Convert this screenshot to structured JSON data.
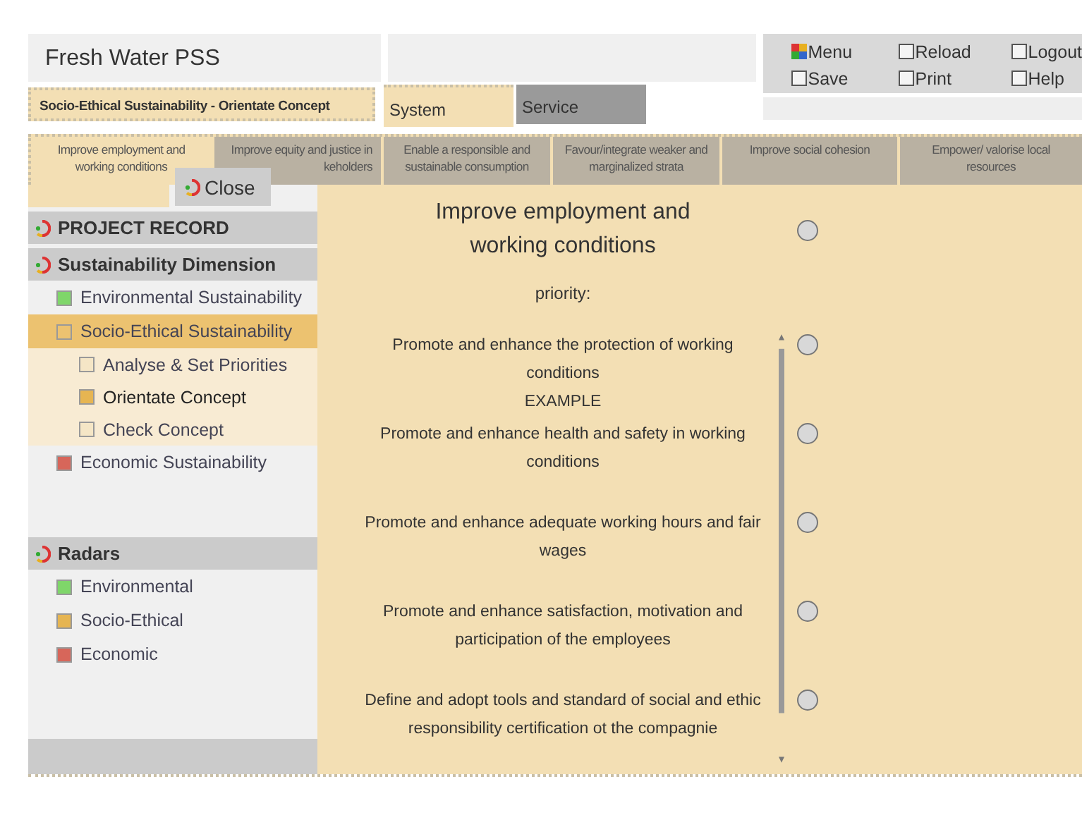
{
  "app_title": "Fresh Water PSS",
  "menu": [
    {
      "label": "Menu",
      "kind": "icon"
    },
    {
      "label": "Reload",
      "kind": "checkbox",
      "checked": false
    },
    {
      "label": "Logout",
      "kind": "checkbox",
      "checked": false
    },
    {
      "label": "Save",
      "kind": "checkbox",
      "checked": false
    },
    {
      "label": "Print",
      "kind": "checkbox",
      "checked": false
    },
    {
      "label": "Help",
      "kind": "checkbox",
      "checked": false
    }
  ],
  "breadcrumb": "Socio-Ethical Sustainability - Orientate Concept",
  "tabs": [
    {
      "label": "System",
      "selected": true
    },
    {
      "label": "Service",
      "selected": false
    }
  ],
  "subtabs": [
    {
      "lines": [
        "Improve employment and",
        "working conditions"
      ],
      "selected": true
    },
    {
      "lines": [
        "Improve equity and justice in",
        "keholders"
      ],
      "selected": false
    },
    {
      "lines": [
        "Enable a responsible and",
        "sustainable consumption"
      ],
      "selected": false
    },
    {
      "lines": [
        "Favour/integrate weaker and",
        "marginalized strata"
      ],
      "selected": false
    },
    {
      "lines": [
        "Improve social cohesion"
      ],
      "selected": false
    },
    {
      "lines": [
        "Empower/ valorise local",
        "resources"
      ],
      "selected": false
    }
  ],
  "close_button": "Close",
  "sidebar": [
    {
      "title": "PROJECT RECORD"
    },
    {
      "title": "Sustainability Dimension",
      "items": [
        {
          "label": "Environmental Sustainability",
          "color": "#7fd66a",
          "selected": false
        },
        {
          "label": "Socio-Ethical Sustainability",
          "color": "#ecc270",
          "selected": true,
          "children": [
            {
              "label": "Analyse & Set Priorities",
              "color": "#f5e6c6",
              "selected": false
            },
            {
              "label": "Orientate Concept",
              "color": "#e6b552",
              "selected": true
            },
            {
              "label": "Check Concept",
              "color": "#f5e6c6",
              "selected": false
            }
          ]
        },
        {
          "label": "Economic Sustainability",
          "color": "#d7665a",
          "selected": false
        }
      ]
    },
    {
      "title": "Radars",
      "items": [
        {
          "label": "Environmental",
          "color": "#7fd66a",
          "selected": false
        },
        {
          "label": "Socio-Ethical",
          "color": "#e6b552",
          "selected": false
        },
        {
          "label": "Economic",
          "color": "#d7665a",
          "selected": false
        }
      ]
    }
  ],
  "content": {
    "heading": "Improve employment and working conditions",
    "heading_selected": false,
    "priority_label": "priority:",
    "items": [
      {
        "text": "Promote and enhance the protection of working conditions",
        "note": "EXAMPLE",
        "selected": false
      },
      {
        "text": "Promote and enhance health and safety in working conditions",
        "selected": false
      },
      {
        "text": "Promote and enhance adequate working hours and fair wages",
        "selected": false
      },
      {
        "text": "Promote and enhance satisfaction, motivation and participation of the employees",
        "selected": false
      },
      {
        "text": "Define and adopt tools and standard of social and ethic responsibility certification ot the compagnie",
        "selected": false
      }
    ]
  }
}
